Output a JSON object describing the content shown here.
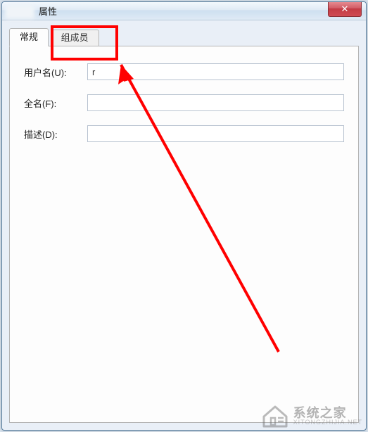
{
  "window": {
    "title": "属性"
  },
  "tabs": {
    "general": "常规",
    "members": "组成员"
  },
  "form": {
    "username_label": "用户名(U):",
    "username_value": "r",
    "fullname_label": "全名(F):",
    "fullname_value": "",
    "description_label": "描述(D):",
    "description_value": ""
  },
  "watermark": {
    "name": "系统之家",
    "url": "XITONGZHIJIA.NET"
  },
  "colors": {
    "highlight": "#ff0000",
    "close_bg": "#c33b44"
  }
}
